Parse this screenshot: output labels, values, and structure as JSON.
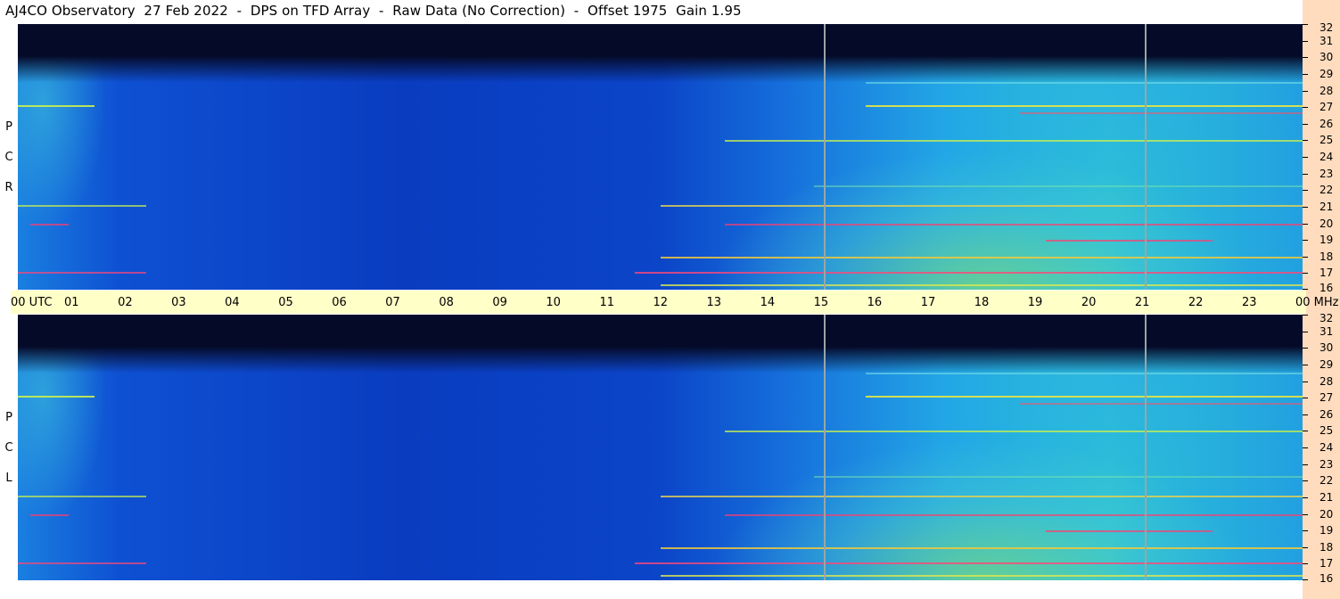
{
  "title": "AJ4CO Observatory  27 Feb 2022  -  DPS on TFD Array  -  Raw Data (No Correction)  -  Offset 1975  Gain 1.95",
  "polarization": {
    "top": [
      "P",
      "C",
      "R"
    ],
    "bottom": [
      "P",
      "C",
      "L"
    ]
  },
  "utc_labels": [
    "00 UTC",
    "01",
    "02",
    "03",
    "04",
    "05",
    "06",
    "07",
    "08",
    "09",
    "10",
    "11",
    "12",
    "13",
    "14",
    "15",
    "16",
    "17",
    "18",
    "19",
    "20",
    "21",
    "22",
    "23",
    "00 MHz"
  ],
  "freq_labels": [
    "32",
    "31",
    "30",
    "29",
    "28",
    "27",
    "26",
    "25",
    "24",
    "23",
    "22",
    "21",
    "20",
    "19",
    "18",
    "17",
    "16"
  ],
  "colors": {
    "background_dark": "#050a28",
    "low": "#0a3cc8",
    "mid": "#1e8cf0",
    "high": "#28c8d2",
    "hot": "#b4f03c",
    "peak": "#ff3250",
    "utc_strip": "#ffffc8",
    "freq_strip": "#ffdcbe"
  },
  "chart_data": {
    "type": "heatmap",
    "panels": [
      "RCP",
      "LCP"
    ],
    "x_range_utc_hours": [
      0,
      24
    ],
    "y_range_mhz": [
      16,
      32
    ],
    "vertical_lines_utc_hours": [
      15.05,
      21.05
    ]
  }
}
